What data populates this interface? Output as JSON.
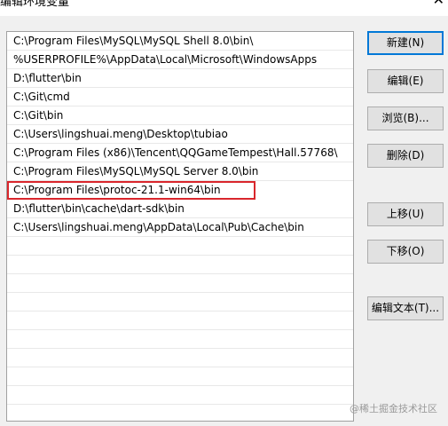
{
  "window": {
    "title": "编辑环境变量",
    "close_glyph": "✕"
  },
  "path_list": {
    "rows": [
      "C:\\Program Files\\MySQL\\MySQL Shell 8.0\\bin\\",
      "%USERPROFILE%\\AppData\\Local\\Microsoft\\WindowsApps",
      "D:\\flutter\\bin",
      "C:\\Git\\cmd",
      "C:\\Git\\bin",
      "C:\\Users\\lingshuai.meng\\Desktop\\tubiao",
      "C:\\Program Files (x86)\\Tencent\\QQGameTempest\\Hall.57768\\",
      "C:\\Program Files\\MySQL\\MySQL Server 8.0\\bin",
      "C:\\Program Files\\protoc-21.1-win64\\bin",
      "D:\\flutter\\bin\\cache\\dart-sdk\\bin",
      "C:\\Users\\lingshuai.meng\\AppData\\Local\\Pub\\Cache\\bin"
    ],
    "highlighted_index": 8,
    "highlight_color": "#d9262c"
  },
  "buttons": {
    "new": "新建(N)",
    "edit": "编辑(E)",
    "browse": "浏览(B)...",
    "delete": "删除(D)",
    "move_up": "上移(U)",
    "move_down": "下移(O)",
    "edit_text": "编辑文本(T)..."
  },
  "watermark": "@稀土掘金技术社区"
}
